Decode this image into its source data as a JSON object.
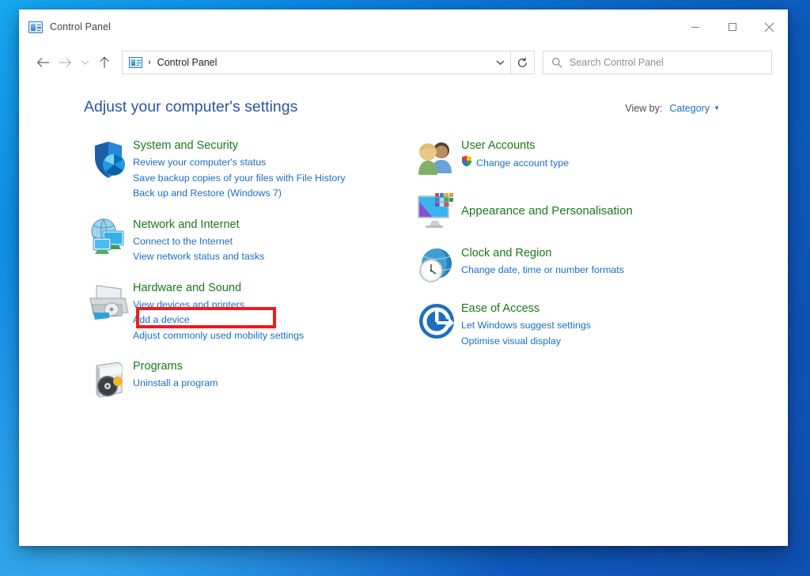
{
  "window": {
    "title": "Control Panel",
    "title_icon": "control-panel-icon",
    "minimize_label": "Minimise",
    "maximize_label": "Maximise",
    "close_label": "Close"
  },
  "nav": {
    "back_label": "Back",
    "forward_label": "Forward",
    "recent_label": "Recent locations",
    "up_label": "Up",
    "breadcrumb_separator": "›",
    "breadcrumb": "Control Panel",
    "address_dropdown_label": "Previous locations",
    "refresh_label": "Refresh",
    "refresh_glyph": "↻"
  },
  "search": {
    "placeholder": "Search Control Panel",
    "value": "",
    "icon": "search-icon"
  },
  "page": {
    "title": "Adjust your computer's settings",
    "view_by_label": "View by:",
    "view_by_value": "Category"
  },
  "highlight": {
    "color": "#ee1c1c",
    "target": "View devices and printers"
  },
  "categories_left": [
    {
      "icon": "shield-security-icon",
      "title": "System and Security",
      "links": [
        "Review your computer's status",
        "Save backup copies of your files with File History",
        "Back up and Restore (Windows 7)"
      ]
    },
    {
      "icon": "network-icon",
      "title": "Network and Internet",
      "links": [
        "Connect to the Internet",
        "View network status and tasks"
      ]
    },
    {
      "icon": "printer-icon",
      "title": "Hardware and Sound",
      "links": [
        "View devices and printers",
        "Add a device",
        "Adjust commonly used mobility settings"
      ]
    },
    {
      "icon": "programs-disc-icon",
      "title": "Programs",
      "links": [
        "Uninstall a program"
      ]
    }
  ],
  "categories_right": [
    {
      "icon": "user-accounts-icon",
      "title": "User Accounts",
      "links": [
        "Change account type"
      ],
      "link_badge": "uac-shield-icon"
    },
    {
      "icon": "appearance-monitor-icon",
      "title": "Appearance and Personalisation",
      "links": []
    },
    {
      "icon": "clock-globe-icon",
      "title": "Clock and Region",
      "links": [
        "Change date, time or number formats"
      ]
    },
    {
      "icon": "ease-of-access-icon",
      "title": "Ease of Access",
      "links": [
        "Let Windows suggest settings",
        "Optimise visual display"
      ]
    }
  ],
  "colors": {
    "category_title": "#1a7a1a",
    "link": "#1a6fc4",
    "page_title": "#2a55a8",
    "desktop": "#0d8ae8",
    "highlight": "#ee1c1c"
  }
}
